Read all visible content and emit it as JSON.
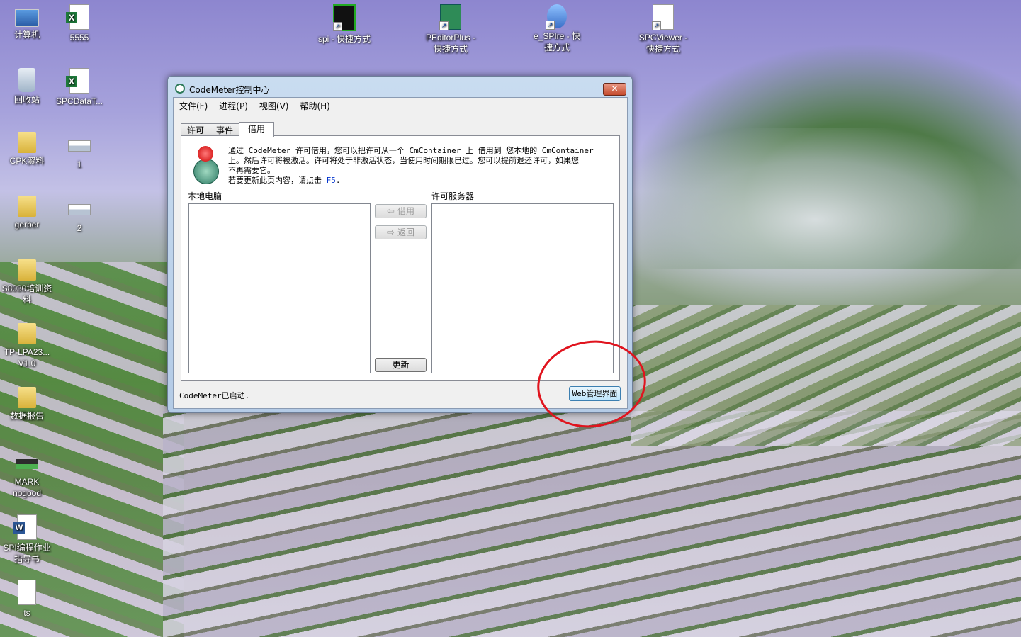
{
  "desktop": {
    "icons": [
      {
        "id": "computer",
        "label": "计算机",
        "icon": "computer-icon"
      },
      {
        "id": "5555",
        "label": "5555",
        "icon": "excel-file-icon"
      },
      {
        "id": "recycle",
        "label": "回收站",
        "icon": "recycle-bin-icon"
      },
      {
        "id": "spcdata",
        "label": "SPCDataT...",
        "icon": "excel-file-icon"
      },
      {
        "id": "cpk",
        "label": "CPK资料",
        "icon": "folder-icon"
      },
      {
        "id": "img1",
        "label": "1",
        "icon": "image-file-icon"
      },
      {
        "id": "gerber",
        "label": "gerber",
        "icon": "folder-icon"
      },
      {
        "id": "img2",
        "label": "2",
        "icon": "image-file-icon"
      },
      {
        "id": "s8030",
        "label": "S8030培训资料",
        "icon": "folder-icon"
      },
      {
        "id": "tplpa",
        "label": "TP-LPA23... V1.0",
        "icon": "folder-icon"
      },
      {
        "id": "report",
        "label": "数据报告",
        "icon": "folder-icon"
      },
      {
        "id": "mark",
        "label": "MARK nogood",
        "icon": "image-file-icon"
      },
      {
        "id": "spidoc",
        "label": "SPI编程作业指导书",
        "icon": "word-file-icon"
      },
      {
        "id": "ts",
        "label": "ts",
        "icon": "blank-file-icon"
      },
      {
        "id": "spi",
        "label": "spi - 快捷方式",
        "icon": "spi-shortcut-icon"
      },
      {
        "id": "peditor",
        "label": "PEditorPlus - 快捷方式",
        "icon": "peditor-shortcut-icon"
      },
      {
        "id": "espire",
        "label": "e_SPIre - 快捷方式",
        "icon": "espire-shortcut-icon"
      },
      {
        "id": "spcviewer",
        "label": "SPCViewer - 快捷方式",
        "icon": "spcviewer-shortcut-icon"
      }
    ]
  },
  "window": {
    "title": "CodeMeter控制中心",
    "close_label": "✕",
    "menu": [
      "文件(F)",
      "进程(P)",
      "视图(V)",
      "帮助(H)"
    ],
    "tabs": [
      "许可",
      "事件",
      "借用"
    ],
    "active_tab": "借用",
    "info_line1": "通过 CodeMeter 许可借用，您可以把许可从一个 CmContainer 上 借用到 您本地的 CmContainer",
    "info_line2": "上。然后许可将被激活。许可将处于非激活状态，当使用时间期限已过。您可以提前退还许可，如果您",
    "info_line3": "不再需要它。",
    "info_line4_prefix": "若要更新此页内容，请点击",
    "info_link": "F5",
    "info_line4_suffix": ".",
    "local_label": "本地电脑",
    "server_label": "许可服务器",
    "borrow_label": "借用",
    "return_label": "返回",
    "refresh_label": "更新",
    "status_text": "CodeMeter已启动.",
    "web_button_label": "Web管理界面"
  },
  "colors": {
    "annotation": "#e0141e",
    "window_frame": "#c9dcf0",
    "close_button": "#c44a2c"
  }
}
